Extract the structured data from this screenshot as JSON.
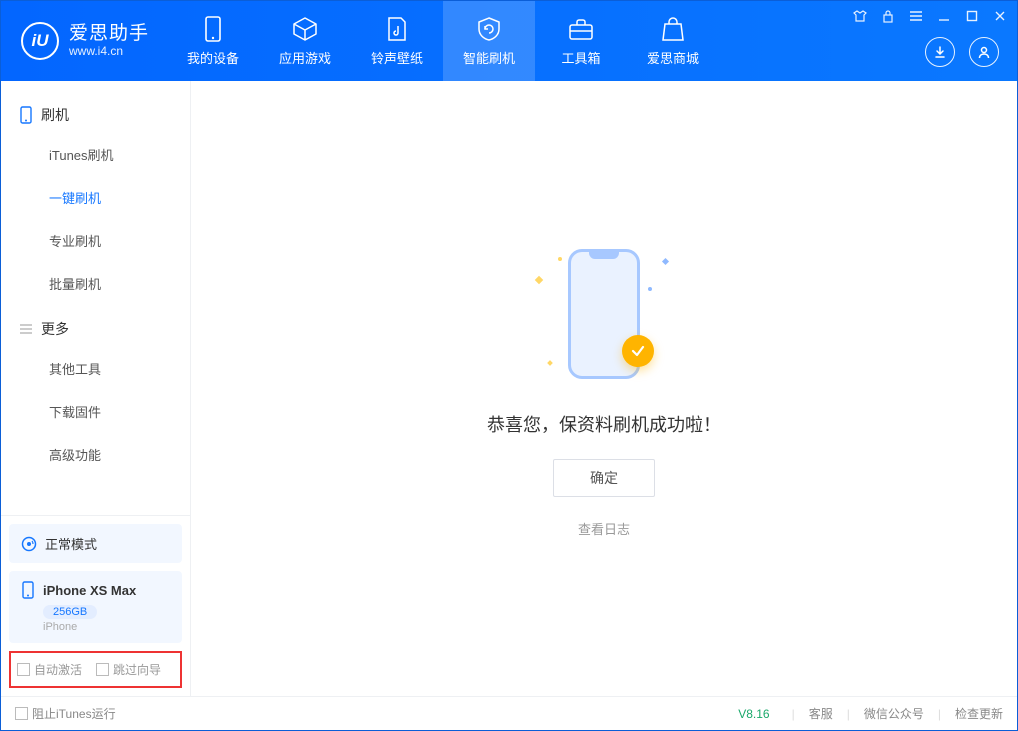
{
  "app": {
    "name_cn": "爱思助手",
    "name_en": "www.i4.cn",
    "logo_letter": "iU"
  },
  "nav": {
    "items": [
      {
        "label": "我的设备"
      },
      {
        "label": "应用游戏"
      },
      {
        "label": "铃声壁纸"
      },
      {
        "label": "智能刷机"
      },
      {
        "label": "工具箱"
      },
      {
        "label": "爱思商城"
      }
    ],
    "active_index": 3
  },
  "sidebar": {
    "group1_title": "刷机",
    "group1_items": [
      {
        "label": "iTunes刷机"
      },
      {
        "label": "一键刷机"
      },
      {
        "label": "专业刷机"
      },
      {
        "label": "批量刷机"
      }
    ],
    "group1_active_index": 1,
    "group2_title": "更多",
    "group2_items": [
      {
        "label": "其他工具"
      },
      {
        "label": "下载固件"
      },
      {
        "label": "高级功能"
      }
    ],
    "mode_label": "正常模式",
    "device": {
      "name": "iPhone XS Max",
      "capacity": "256GB",
      "type": "iPhone"
    },
    "options": {
      "auto_activate": "自动激活",
      "skip_guide": "跳过向导"
    }
  },
  "main": {
    "success_text": "恭喜您，保资料刷机成功啦！",
    "ok_button": "确定",
    "view_log": "查看日志"
  },
  "footer": {
    "block_itunes": "阻止iTunes运行",
    "version": "V8.16",
    "links": {
      "support": "客服",
      "wechat": "微信公众号",
      "check_update": "检查更新"
    }
  },
  "colors": {
    "primary": "#1677ff",
    "accent": "#ffb400"
  }
}
